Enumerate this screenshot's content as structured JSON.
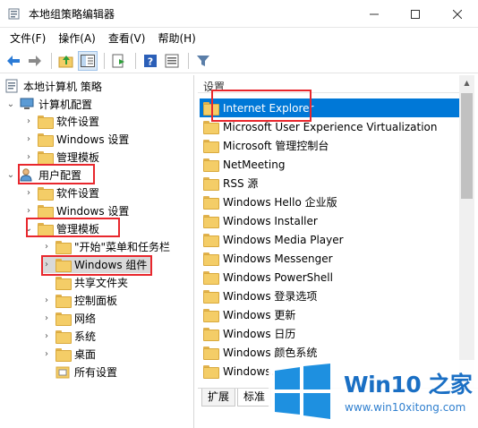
{
  "window": {
    "title": "本地组策略编辑器",
    "controls": {
      "minimize": "—",
      "maximize": "☐",
      "close": "✕"
    }
  },
  "menu": [
    "文件(F)",
    "操作(A)",
    "查看(V)",
    "帮助(H)"
  ],
  "toolbar": {
    "icons": [
      "back-icon",
      "forward-icon",
      "up-folder-icon",
      "show-hide-tree-icon",
      "export-list-icon",
      "help-icon",
      "properties-icon",
      "filter-icon"
    ]
  },
  "tree": [
    {
      "label": "本地计算机 策略",
      "icon": "policy-icon",
      "chevron": "",
      "indent": 0
    },
    {
      "label": "计算机配置",
      "icon": "computer-icon",
      "chevron": "⌄",
      "indent": 1
    },
    {
      "label": "软件设置",
      "icon": "folder-icon",
      "chevron": "›",
      "indent": 2
    },
    {
      "label": "Windows 设置",
      "icon": "folder-icon",
      "chevron": "›",
      "indent": 2
    },
    {
      "label": "管理模板",
      "icon": "folder-icon",
      "chevron": "›",
      "indent": 2
    },
    {
      "label": "用户配置",
      "icon": "user-icon",
      "chevron": "⌄",
      "indent": 1
    },
    {
      "label": "软件设置",
      "icon": "folder-icon",
      "chevron": "›",
      "indent": 2
    },
    {
      "label": "Windows 设置",
      "icon": "folder-icon",
      "chevron": "›",
      "indent": 2
    },
    {
      "label": "管理模板",
      "icon": "folder-icon",
      "chevron": "⌄",
      "indent": 2
    },
    {
      "label": "\"开始\"菜单和任务栏",
      "icon": "folder-icon",
      "chevron": "›",
      "indent": 3
    },
    {
      "label": "Windows 组件",
      "icon": "folder-icon",
      "chevron": "›",
      "indent": 3
    },
    {
      "label": "共享文件夹",
      "icon": "folder-icon",
      "chevron": "",
      "indent": 3
    },
    {
      "label": "控制面板",
      "icon": "folder-icon",
      "chevron": "›",
      "indent": 3
    },
    {
      "label": "网络",
      "icon": "folder-icon",
      "chevron": "›",
      "indent": 3
    },
    {
      "label": "系统",
      "icon": "folder-icon",
      "chevron": "›",
      "indent": 3
    },
    {
      "label": "桌面",
      "icon": "folder-icon",
      "chevron": "›",
      "indent": 3
    },
    {
      "label": "所有设置",
      "icon": "all-settings-icon",
      "chevron": "",
      "indent": 3
    }
  ],
  "list": {
    "header": "设置",
    "items": [
      "Internet Explorer",
      "Microsoft User Experience Virtualization",
      "Microsoft 管理控制台",
      "NetMeeting",
      "RSS 源",
      "Windows Hello 企业版",
      "Windows Installer",
      "Windows Media Player",
      "Windows Messenger",
      "Windows PowerShell",
      "Windows 登录选项",
      "Windows 更新",
      "Windows 日历",
      "Windows 颜色系统",
      "Windows..."
    ],
    "selected_index": 0
  },
  "tabs": [
    "扩展",
    "标准"
  ],
  "watermark": {
    "title": "Win10 之家",
    "url": "www.win10xitong.com"
  },
  "colors": {
    "selection": "#0078d7",
    "highlight_box": "#e8272d",
    "watermark_blue": "#1a6fc4"
  }
}
